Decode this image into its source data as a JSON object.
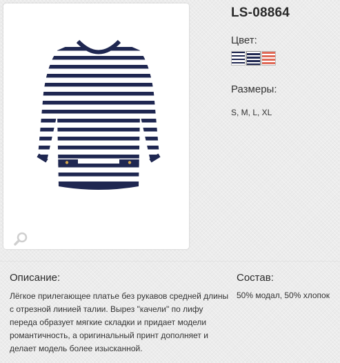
{
  "product": {
    "sku": "LS-08864",
    "image_alt": "Striped top",
    "zoom_icon": "magnifier-icon"
  },
  "color": {
    "label": "Цвет:",
    "swatches": [
      {
        "name": "navy-white-stripe",
        "color": "#1f2751"
      },
      {
        "name": "white-navy-stripe",
        "color": "#1f2751"
      },
      {
        "name": "coral-white-stripe",
        "color": "#e06a58"
      }
    ]
  },
  "sizes": {
    "label": "Размеры:",
    "value": "S, M, L, XL"
  },
  "description": {
    "title": "Описание:",
    "text": "Лёгкое прилегающее платье без рукавов средней длины с отрезной линией талии. Вырез \"качели\" по лифу переда образует мягкие складки и придает модели романтичность, а оригинальный принт дополняет и  делает модель более изысканной."
  },
  "composition": {
    "title": "Состав:",
    "text": "50% модал, 50% хлопок"
  },
  "colors": {
    "navy": "#1f2751",
    "background": "#ececec"
  }
}
